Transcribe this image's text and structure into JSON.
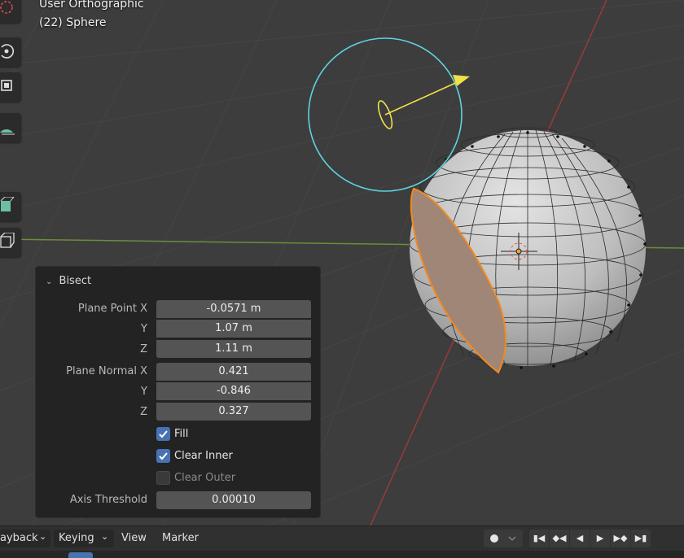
{
  "viewport": {
    "view_name": "User Orthographic",
    "object_name": "(22) Sphere"
  },
  "toolbar": {
    "icons": [
      "cursor-icon",
      "rotate-icon",
      "scale-icon",
      "measure-icon",
      "cube-add-icon",
      "cube-wire-icon",
      "extrude-icon",
      "sphere-icon",
      "grid-icon",
      "cube-icon"
    ]
  },
  "bisect_panel": {
    "title": "Bisect",
    "plane_point_label": "Plane Point X",
    "plane_point_y_label": "Y",
    "plane_point_z_label": "Z",
    "plane_point_x": "-0.0571 m",
    "plane_point_y": "1.07 m",
    "plane_point_z": "1.11 m",
    "plane_normal_label": "Plane Normal X",
    "plane_normal_y_label": "Y",
    "plane_normal_z_label": "Z",
    "plane_normal_x": "0.421",
    "plane_normal_y": "-0.846",
    "plane_normal_z": "0.327",
    "fill_label": "Fill",
    "fill_checked": true,
    "clear_inner_label": "Clear Inner",
    "clear_inner_checked": true,
    "clear_outer_label": "Clear Outer",
    "clear_outer_checked": false,
    "axis_threshold_label": "Axis Threshold",
    "axis_threshold": "0.00010"
  },
  "timeline": {
    "playback_label": "ayback",
    "keying_label": "Keying",
    "view_label": "View",
    "marker_label": "Marker"
  },
  "colors": {
    "accent": "#4772b3",
    "selection": "#f28a1e",
    "gizmo_circle": "#5fd3df",
    "gizmo_arrow": "#f0e04a"
  }
}
